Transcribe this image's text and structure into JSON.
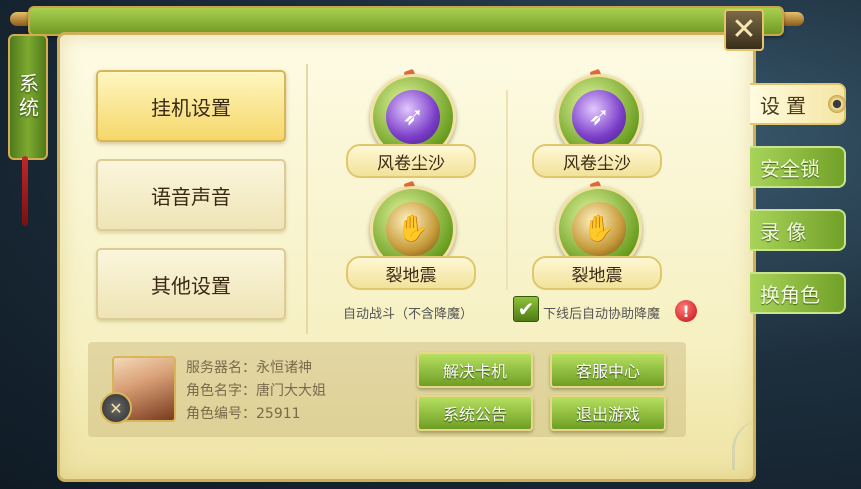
{
  "window": {
    "side_tag": "系统",
    "close_glyph": "✕"
  },
  "menu": {
    "items": [
      {
        "label": "挂机设置",
        "active": true
      },
      {
        "label": "语音声音",
        "active": false
      },
      {
        "label": "其他设置",
        "active": false
      }
    ]
  },
  "skills": {
    "auto_battle": [
      {
        "name": "风卷尘沙",
        "icon": "tornado-icon"
      },
      {
        "name": "裂地震",
        "icon": "earthquake-icon"
      }
    ],
    "offline_assist": [
      {
        "name": "风卷尘沙",
        "icon": "tornado-icon"
      },
      {
        "name": "裂地震",
        "icon": "earthquake-icon"
      }
    ],
    "auto_battle_caption": "自动战斗（不含降魔）",
    "offline_assist_caption": "下线后自动协助降魔",
    "offline_assist_checked": true,
    "warning_glyph": "!"
  },
  "profile": {
    "server": "服务器名：永恒诸神",
    "role_name": "角色名字：唐门大大姐",
    "role_id": "角色编号：25911",
    "badge_glyph": "✕"
  },
  "actions": {
    "unstuck": "解决卡机",
    "support": "客服中心",
    "announcement": "系统公告",
    "logout": "退出游戏"
  },
  "tabs": [
    {
      "label": "设置",
      "active": true
    },
    {
      "label": "安全锁",
      "active": false
    },
    {
      "label": "录 像",
      "active": false
    },
    {
      "label": "换角色",
      "active": false
    }
  ],
  "colors": {
    "panel_bg": "#f6f0c2",
    "accent_green": "#7eaa30",
    "border_gold": "#cdb15a",
    "warning_red": "#c20e0e"
  }
}
